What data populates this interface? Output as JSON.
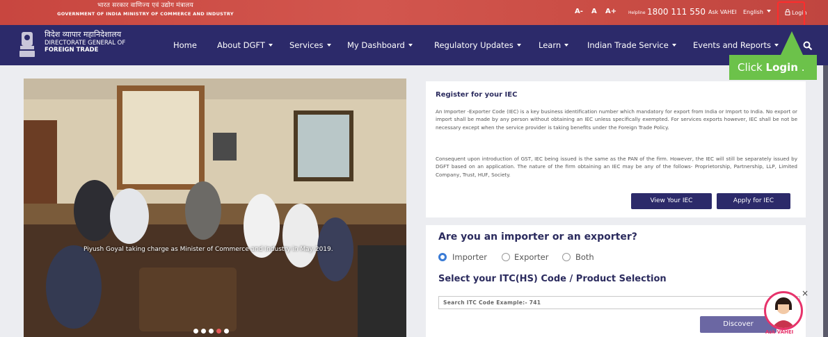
{
  "topbar": {
    "govt_hindi": "भारत सरकार   वाणिज्य एवं उद्योग मंत्रालय",
    "govt_english": "GOVERNMENT OF INDIA   MINISTRY OF COMMERCE AND INDUSTRY",
    "font_small": "A-",
    "font_normal": "A",
    "font_large": "A+",
    "helpline_label": "Helpline",
    "helpline_number": "1800 111 550",
    "ask_vahei": "Ask VAHEI",
    "language": "English",
    "login": "Login"
  },
  "nav": {
    "org_hindi": "विदेश व्यापार महानिदेशालय",
    "org_line2": "DIRECTORATE GENERAL OF",
    "org_line3": "FOREIGN TRADE",
    "items": [
      "Home",
      "About DGFT",
      "Services",
      "My Dashboard",
      "Regulatory Updates",
      "Learn",
      "Indian Trade Service",
      "Events and Reports"
    ]
  },
  "callout": {
    "prefix": "Click ",
    "bold": "Login",
    "suffix": " ."
  },
  "slider": {
    "caption": "Piyush Goyal taking charge as Minister of Commerce and Industry in May 2019.",
    "active_dot_index": 3
  },
  "register": {
    "title": "Register for your IEC",
    "para1": "An Importer -Exporter Code (IEC) is a key business identification number which mandatory for export from India or Import to India. No export or import shall be made by any person without obtaining an IEC unless specifically exempted. For services exports however, IEC shall be not be necessary except when the service provider is taking benefits under the Foreign Trade Policy.",
    "para2": "Consequent upon introduction of GST, IEC being issued is the same as the PAN of the firm. However, the IEC will still be separately issued by DGFT based on an application. The nature of the firm obtaining an IEC may be any of the follows- Proprietorship, Partnership, LLP, Limited Company, Trust, HUF, Society.",
    "view_btn": "View Your IEC",
    "apply_btn": "Apply for IEC"
  },
  "importer": {
    "title": "Are you an importer or an exporter?",
    "options": [
      "Importer",
      "Exporter",
      "Both"
    ],
    "selected": "Importer",
    "sub_title": "Select your ITC(HS) Code / Product Selection",
    "search_placeholder": "Search ITC Code Example:- 741",
    "discover_btn": "Discover"
  },
  "vahei": {
    "label": "Ask VAHEI",
    "close": "×"
  },
  "colors": {
    "topbar": "#c8463f",
    "navbar": "#2c2a6a",
    "callout": "#6cc24a",
    "highlight": "#ff2c2c",
    "button": "#2c2a6a"
  },
  "icons": {
    "search": "search-icon",
    "login": "lock-icon",
    "emblem": "emblem-icon"
  }
}
